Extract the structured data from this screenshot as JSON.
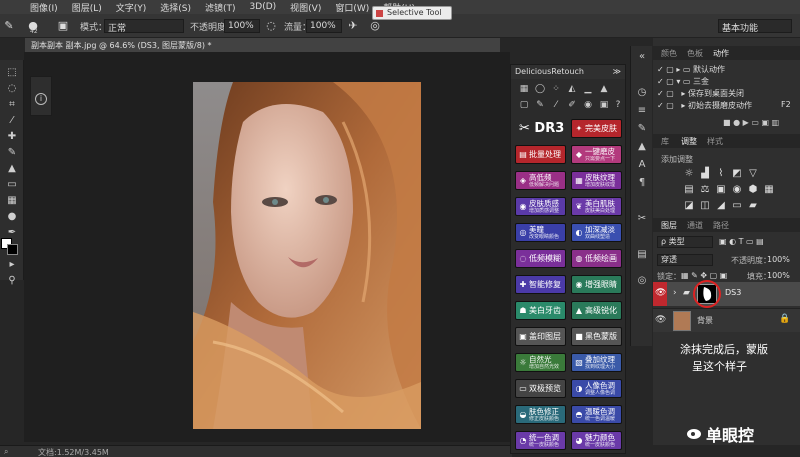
{
  "menu": [
    "图像(I)",
    "图层(L)",
    "文字(Y)",
    "选择(S)",
    "滤镜(T)",
    "3D(D)",
    "视图(V)",
    "窗口(W)",
    "帮助(H)"
  ],
  "options": {
    "brush_size": "42",
    "mode_label": "模式：",
    "mode_value": "正常",
    "opacity_label": "不透明度：",
    "opacity_value": "100%",
    "flow_label": "流量：",
    "flow_value": "100%",
    "workspace": "基本功能"
  },
  "selective_tool": "Selective Tool",
  "document_tab": "副本副本 副本.jpg @ 64.6% (DS3, 图层蒙版/8) *",
  "status": {
    "doc": "文档:1.52M/3.45M"
  },
  "dr3": {
    "panel_title": "DeliciousRetouch",
    "logo": "DR3",
    "buttons": [
      {
        "t1": "完美皮肤",
        "t2": "",
        "color": "#b5262c",
        "icon": "✦"
      },
      {
        "t1": "批量处理",
        "t2": "",
        "color": "#b5262c",
        "icon": "▤"
      },
      {
        "t1": "一键磨皮",
        "t2": "只需要点一下",
        "color": "#b33a7d",
        "icon": "◆"
      },
      {
        "t1": "高低频",
        "t2": "低频解决问题",
        "color": "#9a2f86",
        "icon": "◈"
      },
      {
        "t1": "皮肤纹理",
        "t2": "增加皮肤纹理",
        "color": "#7a2f9a",
        "icon": "▦"
      },
      {
        "t1": "皮肤质感",
        "t2": "增加质感调整",
        "color": "#5a3aa8",
        "icon": "◉"
      },
      {
        "t1": "美白肌肤",
        "t2": "皮肤美白处理",
        "color": "#6b3aa8",
        "icon": "❦"
      },
      {
        "t1": "美瞳",
        "t2": "改变眼睛颜色",
        "color": "#3a3fa8",
        "icon": "◎"
      },
      {
        "t1": "加深减淡",
        "t2": "双曲线塑造",
        "color": "#3a4fb0",
        "icon": "◐"
      },
      {
        "t1": "低频模糊",
        "t2": "",
        "color": "#7a2f9a",
        "icon": "◌"
      },
      {
        "t1": "低频绘画",
        "t2": "",
        "color": "#8a2f8a",
        "icon": "◍"
      },
      {
        "t1": "智能修复",
        "t2": "",
        "color": "#4b3aa8",
        "icon": "✚"
      },
      {
        "t1": "增强眼睛",
        "t2": "",
        "color": "#2a7a5a",
        "icon": "◉"
      },
      {
        "t1": "美白牙齿",
        "t2": "",
        "color": "#2a8a6a",
        "icon": "☗"
      },
      {
        "t1": "高级锐化",
        "t2": "",
        "color": "#2a7a5a",
        "icon": "▲"
      },
      {
        "t1": "盖印图层",
        "t2": "",
        "color": "#555",
        "icon": "▣"
      },
      {
        "t1": "黑色蒙版",
        "t2": "",
        "color": "#555",
        "icon": "■"
      },
      {
        "t1": "自然光",
        "t2": "增加自然光效",
        "color": "#3a7a3a",
        "icon": "☼"
      },
      {
        "t1": "叠加纹理",
        "t2": "找到纹理大小",
        "color": "#3a5aa8",
        "icon": "▧"
      },
      {
        "t1": "双极预览",
        "t2": "",
        "color": "#444",
        "icon": "▭"
      },
      {
        "t1": "人像色调",
        "t2": "调整人像色调",
        "color": "#3a4aa8",
        "icon": "◑"
      },
      {
        "t1": "肤色修正",
        "t2": "修正皮肤颜色",
        "color": "#2a6a7a",
        "icon": "◒"
      },
      {
        "t1": "温暖色调",
        "t2": "统一色调温暖",
        "color": "#3a4aa8",
        "icon": "◓"
      },
      {
        "t1": "统一色调",
        "t2": "统一皮肤颜色",
        "color": "#6a3aa8",
        "icon": "◔"
      },
      {
        "t1": "魅力颜色",
        "t2": "统一皮肤颜色",
        "color": "#6a3aa8",
        "icon": "◕"
      }
    ]
  },
  "panels": {
    "top_tabs": [
      "颜色",
      "色板",
      "动作"
    ],
    "actions": [
      "默认动作",
      "三金",
      "保存到桌面关闭",
      "初始去摄磨皮动作"
    ],
    "action_shortcut": "F2",
    "mid_tabs": [
      "库",
      "调整",
      "样式"
    ],
    "adjust_label": "添加调整",
    "layer_tabs": [
      "图层",
      "通道",
      "路径"
    ],
    "filter_kind": "ρ 类型",
    "blend_mode": "穿透",
    "opacity_label": "不透明度：",
    "opacity_value": "100%",
    "lock_label": "锁定：",
    "fill_label": "填充：",
    "fill_value": "100%",
    "layers": [
      {
        "name": "DS3"
      },
      {
        "name": "背景"
      }
    ]
  },
  "annotation": [
    "涂抹完成后，蒙版",
    "呈这个样子"
  ],
  "watermark": "单眼控",
  "colors": {
    "accent_red": "#c0282e",
    "panel_bg": "#2f2f2f",
    "canvas_bg": "#1f1f1f"
  }
}
